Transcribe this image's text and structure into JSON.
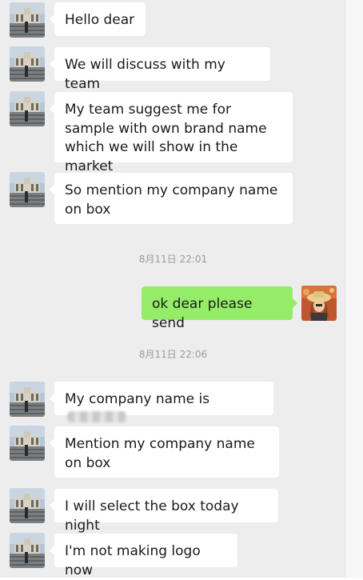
{
  "messages": [
    {
      "side": "left",
      "text": "Hello dear"
    },
    {
      "side": "left",
      "text": "We will discuss with my team"
    },
    {
      "side": "left",
      "text": "My team suggest me for sample with own brand name which we will show in the market"
    },
    {
      "side": "left",
      "text": "So mention my company name on box"
    },
    {
      "type": "timestamp",
      "text": "8月11日 22:01"
    },
    {
      "side": "right",
      "text": "ok dear please send"
    },
    {
      "type": "timestamp",
      "text": "8月11日 22:06"
    },
    {
      "side": "left",
      "text": "My company name is"
    },
    {
      "side": "left",
      "text": "Mention my company name on box"
    },
    {
      "side": "left",
      "text": "I will select the box today night"
    },
    {
      "side": "left",
      "text": "I'm not making logo now"
    }
  ],
  "colors": {
    "chat_background": "#ededed",
    "incoming_bubble": "#ffffff",
    "outgoing_bubble": "#95ec69",
    "timestamp_text": "#9c9c9c"
  },
  "icons": {
    "contact_avatar": "building-photo-avatar",
    "self_avatar": "person-with-hat-photo-avatar"
  }
}
